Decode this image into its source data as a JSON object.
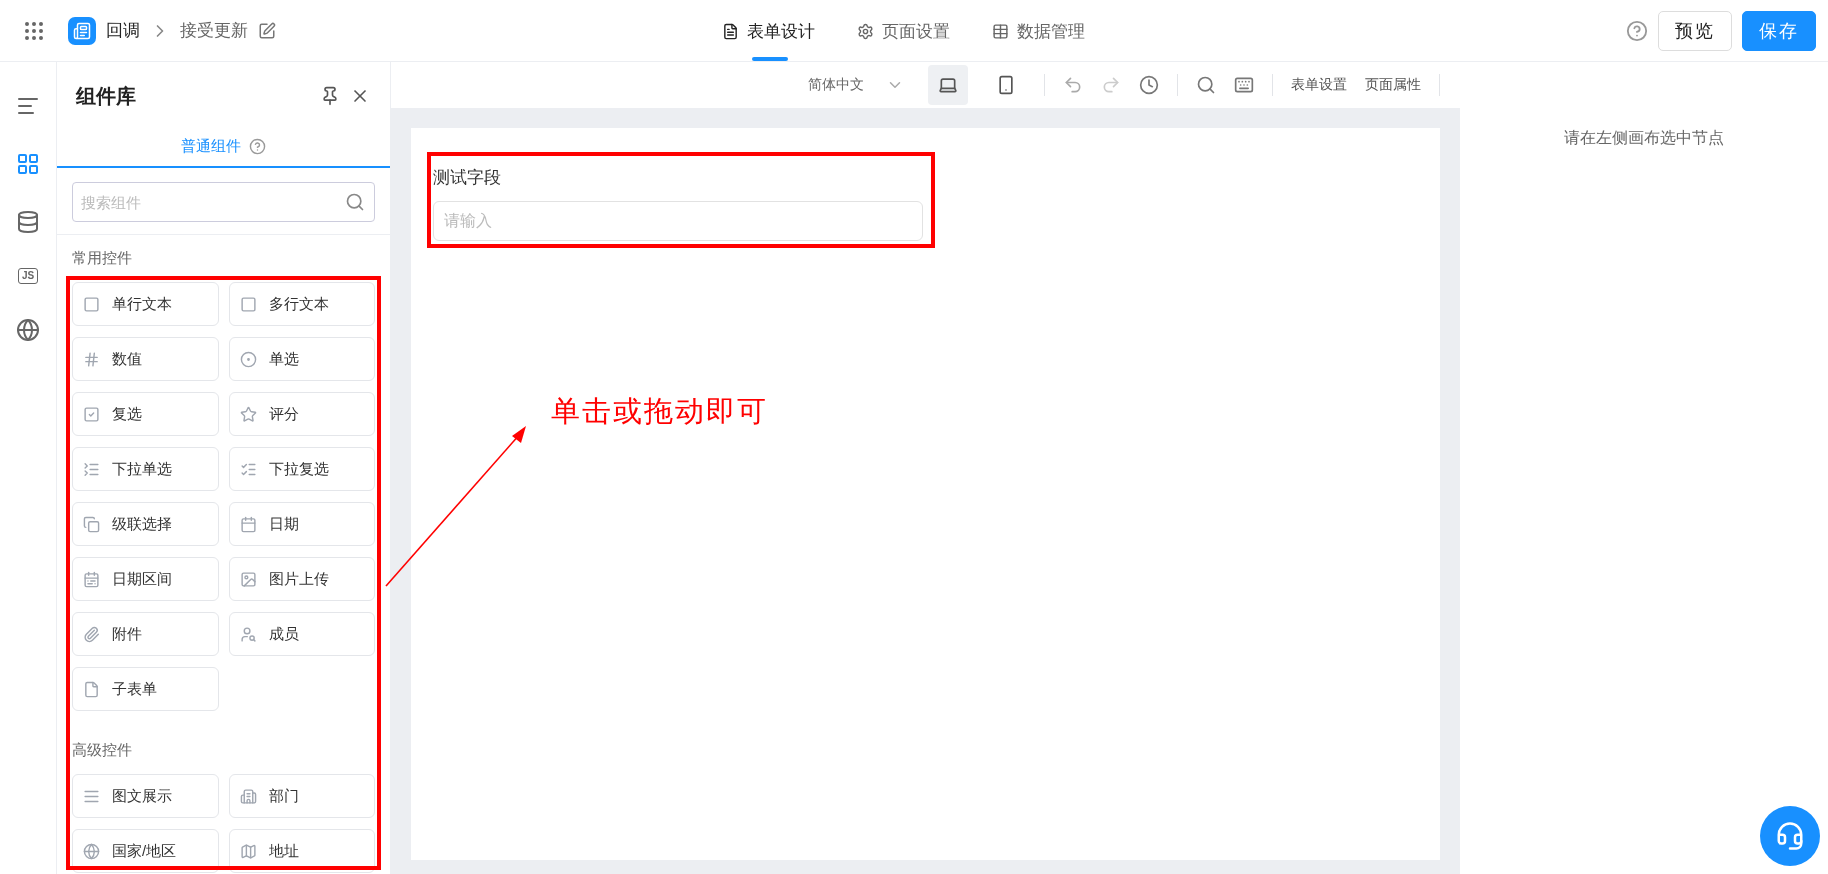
{
  "top_bar": {
    "app_name": "回调",
    "page_name": "接受更新",
    "tabs": [
      {
        "kind": "form",
        "label": "表单设计",
        "selected": true
      },
      {
        "kind": "page",
        "label": "页面设置",
        "selected": false
      },
      {
        "kind": "data",
        "label": "数据管理",
        "selected": false
      }
    ],
    "preview_button": "预览",
    "save_button": "保存"
  },
  "side_rail": [
    {
      "kind": "outline",
      "selected": false
    },
    {
      "kind": "components",
      "selected": true
    },
    {
      "kind": "datasource",
      "selected": false
    },
    {
      "kind": "code",
      "label": "JS",
      "selected": false
    },
    {
      "kind": "globe",
      "selected": false
    }
  ],
  "component_panel": {
    "title": "组件库",
    "tab": {
      "label": "普通组件",
      "selected": true
    },
    "search": {
      "placeholder": "搜索组件"
    },
    "groups": [
      {
        "title": "常用控件",
        "items": [
          {
            "kind": "text",
            "label": "单行文本"
          },
          {
            "kind": "textarea",
            "label": "多行文本"
          },
          {
            "kind": "number",
            "label": "数值"
          },
          {
            "kind": "radio",
            "label": "单选"
          },
          {
            "kind": "checkbox",
            "label": "复选"
          },
          {
            "kind": "rate",
            "label": "评分"
          },
          {
            "kind": "select",
            "label": "下拉单选"
          },
          {
            "kind": "multiselect",
            "label": "下拉复选"
          },
          {
            "kind": "cascader",
            "label": "级联选择"
          },
          {
            "kind": "date",
            "label": "日期"
          },
          {
            "kind": "daterange",
            "label": "日期区间"
          },
          {
            "kind": "image",
            "label": "图片上传"
          },
          {
            "kind": "attachment",
            "label": "附件"
          },
          {
            "kind": "member",
            "label": "成员"
          },
          {
            "kind": "subform",
            "label": "子表单"
          }
        ]
      },
      {
        "title": "高级控件",
        "items": [
          {
            "kind": "richtext",
            "label": "图文展示"
          },
          {
            "kind": "department",
            "label": "部门"
          },
          {
            "kind": "country",
            "label": "国家/地区"
          },
          {
            "kind": "address",
            "label": "地址"
          }
        ]
      }
    ]
  },
  "toolbar": {
    "language": "简体中文",
    "devices": [
      {
        "kind": "desktop",
        "selected": true
      },
      {
        "kind": "mobile",
        "selected": false
      }
    ],
    "links": [
      "表单设置",
      "页面属性"
    ]
  },
  "canvas": {
    "fields": [
      {
        "label": "测试字段",
        "placeholder": "请输入"
      }
    ]
  },
  "right_panel": {
    "empty_text": "请在左侧画布选中节点"
  },
  "annotation": {
    "text": "单击或拖动即可"
  }
}
